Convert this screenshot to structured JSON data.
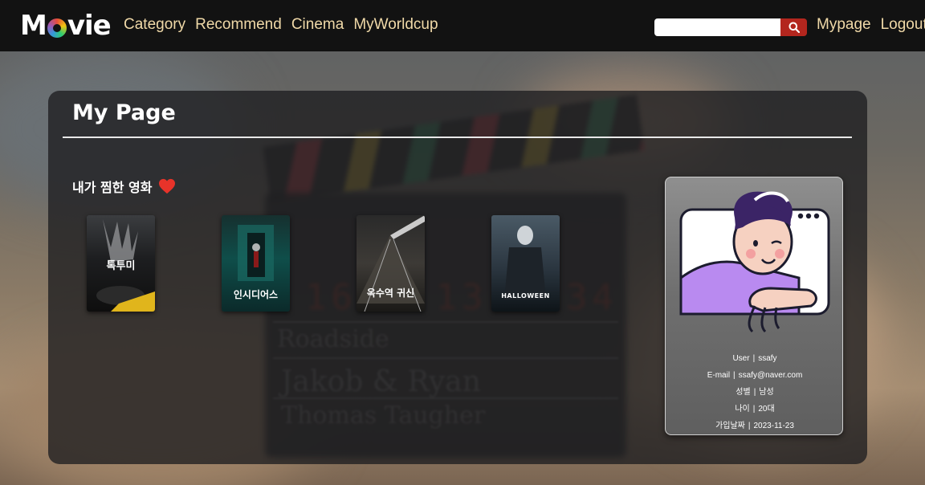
{
  "header": {
    "logo": "Movie",
    "nav": [
      "Category",
      "Recommend",
      "Cinema",
      "MyWorldcup"
    ],
    "search": {
      "value": "",
      "placeholder": ""
    },
    "right": [
      "Mypage",
      "Logout"
    ],
    "accent": "#b3261e",
    "link_color": "#f0d9a8"
  },
  "page": {
    "title": "My Page",
    "liked_section": "내가 찜한 영화",
    "liked_icon": "heart-icon"
  },
  "movies": [
    {
      "poster_title": "톡투미"
    },
    {
      "poster_title": "인시디어스"
    },
    {
      "poster_title": "옥수역 귀신"
    },
    {
      "poster_title": "HALLOWEEN"
    }
  ],
  "profile": {
    "rows": [
      {
        "label": "User",
        "value": "ssafy"
      },
      {
        "label": "E-mail",
        "value": "ssafy@naver.com"
      },
      {
        "label": "성별",
        "value": "남성"
      },
      {
        "label": "나이",
        "value": "20대"
      },
      {
        "label": "가입날짜",
        "value": "2023-11-23"
      }
    ]
  }
}
